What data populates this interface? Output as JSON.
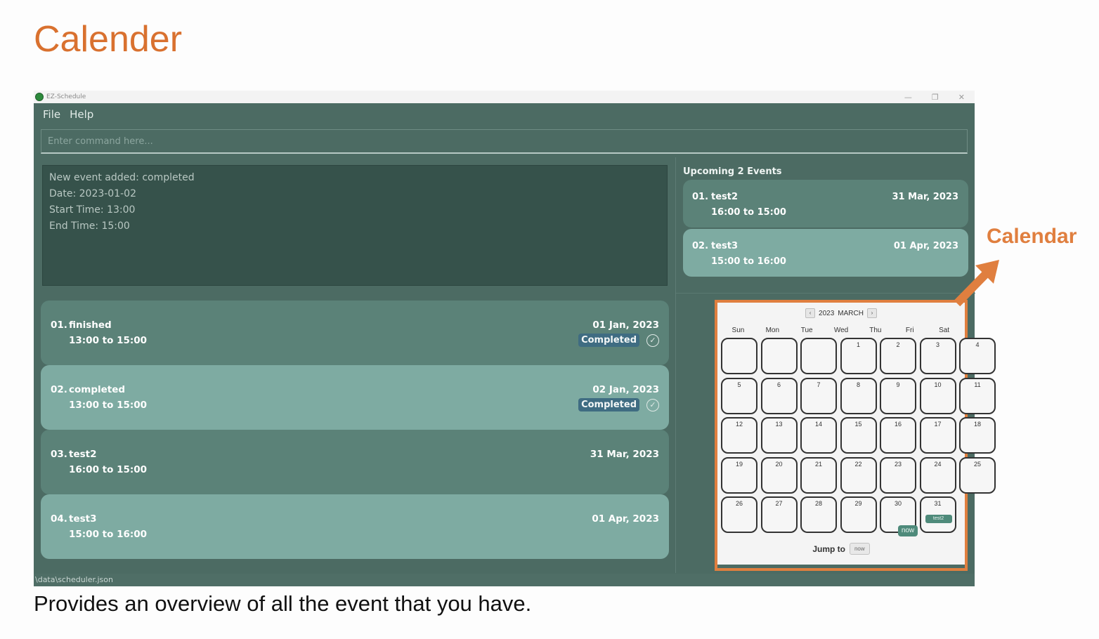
{
  "page": {
    "title": "Calender",
    "caption": "Provides an overview of all the event that you have.",
    "callout_label": "Calendar",
    "accent_color": "#e07f3f"
  },
  "window": {
    "title": "EZ-Schedule",
    "minimize_icon": "minimize-icon",
    "maximize_icon": "restore-icon",
    "close_icon": "close-icon"
  },
  "menu": {
    "file": "File",
    "help": "Help"
  },
  "command": {
    "placeholder": "Enter command here...",
    "value": ""
  },
  "result": {
    "line1": "New event added: completed",
    "line2": "Date: 2023-01-02",
    "line3": "Start Time: 13:00",
    "line4": "End Time: 15:00"
  },
  "events": [
    {
      "num": "01.",
      "name": "finished",
      "time": "13:00 to 15:00",
      "date": "01 Jan, 2023",
      "badge": "Completed",
      "completed": true
    },
    {
      "num": "02.",
      "name": "completed",
      "time": "13:00 to 15:00",
      "date": "02 Jan, 2023",
      "badge": "Completed",
      "completed": true
    },
    {
      "num": "03.",
      "name": "test2",
      "time": "16:00 to 15:00",
      "date": "31 Mar, 2023",
      "badge": "",
      "completed": false
    },
    {
      "num": "04.",
      "name": "test3",
      "time": "15:00 to 16:00",
      "date": "01 Apr, 2023",
      "badge": "",
      "completed": false
    }
  ],
  "upcoming": {
    "title": "Upcoming 2 Events",
    "items": [
      {
        "num": "01.",
        "name": "test2",
        "time": "16:00 to 15:00",
        "date": "31 Mar, 2023"
      },
      {
        "num": "02.",
        "name": "test3",
        "time": "15:00 to 16:00",
        "date": "01 Apr, 2023"
      }
    ]
  },
  "calendar": {
    "year": "2023",
    "month": "MARCH",
    "prev_label": "‹",
    "next_label": "›",
    "day_names": [
      "Sun",
      "Mon",
      "Tue",
      "Wed",
      "Thu",
      "Fri",
      "Sat"
    ],
    "first_weekday": 3,
    "days_in_month": 31,
    "events_on_day": {
      "31": "test2"
    },
    "today_day": 30,
    "today_label": "now",
    "jump_label": "Jump to",
    "jump_button": "now"
  },
  "status": {
    "path": "\\data\\scheduler.json"
  }
}
